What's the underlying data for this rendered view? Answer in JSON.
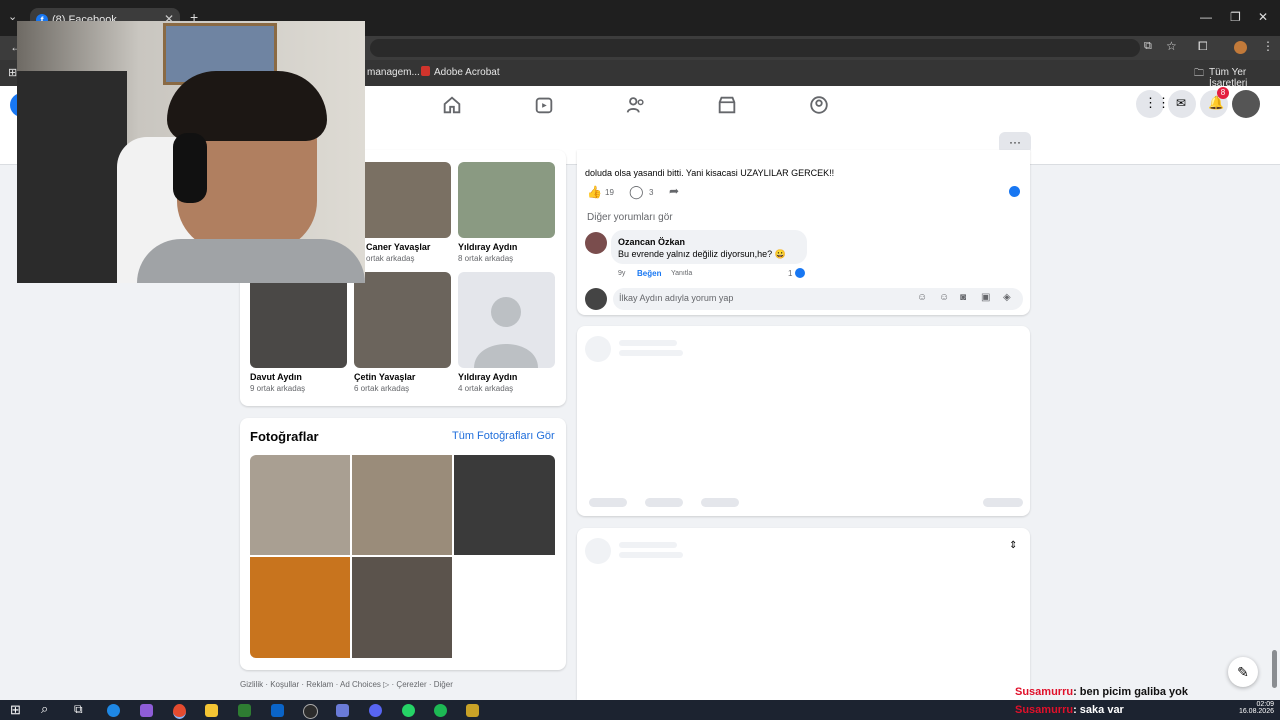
{
  "browser": {
    "tab_title": "(8) Facebook",
    "bookmarks": [
      "managem...",
      "Adobe Acrobat"
    ],
    "all_bookmarks": "Tüm Yer İşaretleri"
  },
  "nav": {
    "notif_count": "8"
  },
  "friends": [
    {
      "name": "Caner Yavaşlar",
      "mutual": "ortak arkadaş"
    },
    {
      "name": "Yıldıray Aydın",
      "mutual": "8 ortak arkadaş"
    },
    {
      "name": "Davut Aydın",
      "mutual": "9 ortak arkadaş"
    },
    {
      "name": "Çetin Yavaşlar",
      "mutual": "6 ortak arkadaş"
    },
    {
      "name": "Yıldıray Aydın",
      "mutual": "4 ortak arkadaş"
    }
  ],
  "photos": {
    "title": "Fotoğraflar",
    "see_all": "Tüm Fotoğrafları Gör"
  },
  "footer_links": "Gizlilik · Koşullar · Reklam · Ad Choices ▷ · Çerezler · Diğer",
  "post": {
    "text_tail": "doluda olsa yasandi bitti. Yani kisacasi UZAYLILAR GERCEK!!",
    "likes": "19",
    "comments": "3",
    "more_comments": "Diğer yorumları gör",
    "comment_author": "Ozancan Özkan",
    "comment_text": "Bu evrende yalnız değiliz diyorsun,he? 😀",
    "comment_time": "9y",
    "comment_like": "Beğen",
    "comment_reply": "Yanıtla",
    "comment_reactions": "1",
    "reply_placeholder": "İlkay Aydın adıyla yorum yap"
  },
  "overlay": {
    "chat_name_1": "Susamurru",
    "chat_msg_1": ": ben picim galiba yok",
    "chat_name_2": "Susamurru",
    "chat_msg_2": ": saka var"
  },
  "clock": {
    "time": "02:09",
    "date": "16.08.2026"
  }
}
